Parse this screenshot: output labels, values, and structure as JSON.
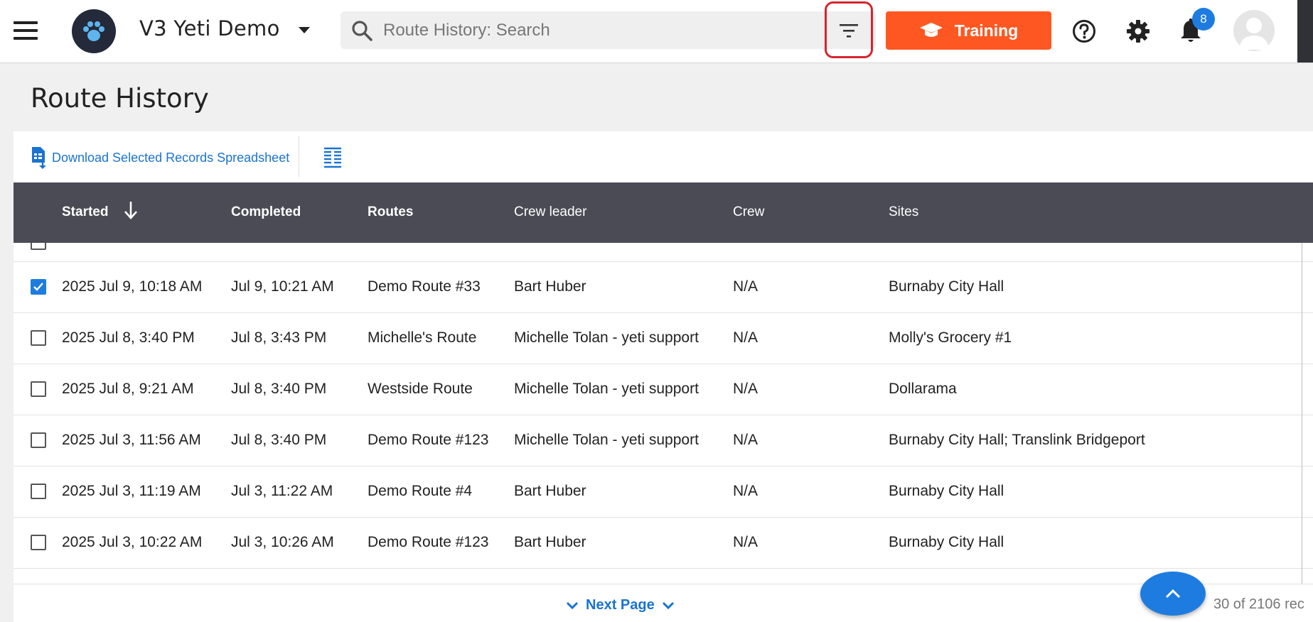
{
  "header": {
    "org_name": "V3 Yeti Demo",
    "search_placeholder": "Route History: Search",
    "training_label": "Training",
    "notification_count": "8",
    "accent_color": "#ff5722",
    "badge_color": "#1e7ce0",
    "icons": [
      "menu-icon",
      "paw-logo",
      "chevron-down-icon",
      "search-icon",
      "filter-icon",
      "graduation-cap-icon",
      "help-icon",
      "gear-icon",
      "bell-icon",
      "avatar-icon"
    ]
  },
  "page": {
    "title": "Route History"
  },
  "toolbar": {
    "download_label": "Download Selected Records Spreadsheet"
  },
  "table": {
    "columns": {
      "started": "Started",
      "completed": "Completed",
      "routes": "Routes",
      "crew_leader": "Crew leader",
      "crew": "Crew",
      "sites": "Sites"
    },
    "sort_column": "Started",
    "sort_direction": "descending",
    "rows": [
      {
        "checked": true,
        "started": "2025 Jul 9, 10:18 AM",
        "completed": "Jul 9, 10:21 AM",
        "route": "Demo Route #33",
        "crew_leader": "Bart Huber",
        "crew": "N/A",
        "sites": "Burnaby City Hall"
      },
      {
        "checked": false,
        "started": "2025 Jul 8, 3:40 PM",
        "completed": "Jul 8, 3:43 PM",
        "route": "Michelle's Route",
        "crew_leader": "Michelle Tolan - yeti support",
        "crew": "N/A",
        "sites": "Molly's Grocery #1"
      },
      {
        "checked": false,
        "started": "2025 Jul 8, 9:21 AM",
        "completed": "Jul 8, 3:40 PM",
        "route": "Westside Route",
        "crew_leader": "Michelle Tolan - yeti support",
        "crew": "N/A",
        "sites": "Dollarama"
      },
      {
        "checked": false,
        "started": "2025 Jul 3, 11:56 AM",
        "completed": "Jul 8, 3:40 PM",
        "route": "Demo Route #123",
        "crew_leader": "Michelle Tolan - yeti support",
        "crew": "N/A",
        "sites": "Burnaby City Hall; Translink Bridgeport"
      },
      {
        "checked": false,
        "started": "2025 Jul 3, 11:19 AM",
        "completed": "Jul 3, 11:22 AM",
        "route": "Demo Route #4",
        "crew_leader": "Bart Huber",
        "crew": "N/A",
        "sites": "Burnaby City Hall"
      },
      {
        "checked": false,
        "started": "2025 Jul 3, 10:22 AM",
        "completed": "Jul 3, 10:26 AM",
        "route": "Demo Route #123",
        "crew_leader": "Bart Huber",
        "crew": "N/A",
        "sites": "Burnaby City Hall"
      }
    ]
  },
  "footer": {
    "next_page_label": "Next Page",
    "record_count": "30 of 2106 rec"
  }
}
